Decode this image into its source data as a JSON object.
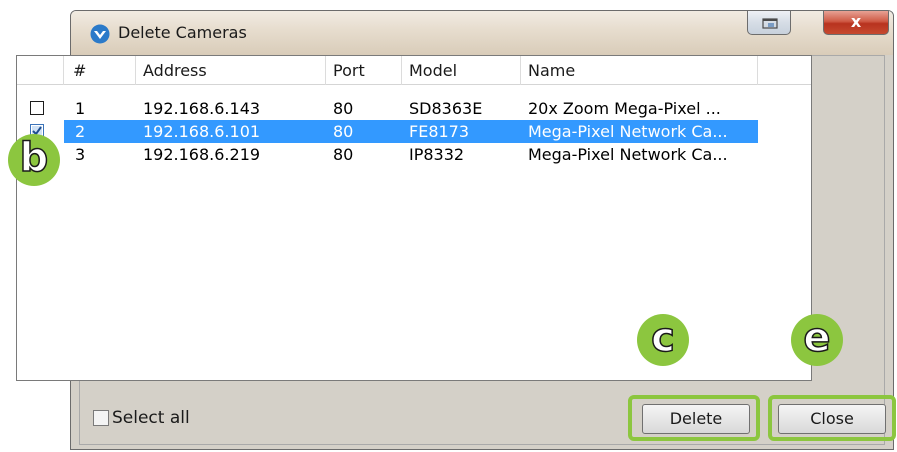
{
  "window": {
    "title": "Delete Cameras",
    "close_glyph": "x"
  },
  "list": {
    "columns": [
      "#",
      "Address",
      "Port",
      "Model",
      "Name"
    ],
    "rows": [
      {
        "checked": false,
        "selected": false,
        "num": "1",
        "address": "192.168.6.143",
        "port": "80",
        "model": "SD8363E",
        "name": "20x Zoom Mega-Pixel ..."
      },
      {
        "checked": true,
        "selected": true,
        "num": "2",
        "address": "192.168.6.101",
        "port": "80",
        "model": "FE8173",
        "name": "Mega-Pixel Network Ca..."
      },
      {
        "checked": false,
        "selected": false,
        "num": "3",
        "address": "192.168.6.219",
        "port": "80",
        "model": "IP8332",
        "name": "Mega-Pixel Network Ca..."
      }
    ]
  },
  "footer": {
    "select_all_label": "Select all",
    "delete_label": "Delete",
    "close_label": "Close"
  },
  "callouts": {
    "b": "b",
    "c": "c",
    "e": "e"
  },
  "colors": {
    "selection": "#3399ff",
    "callout": "#8cc63f",
    "close_button": "#c6492f"
  },
  "icons": {
    "app": "vivotek-logo-icon",
    "restore": "restore-window-icon",
    "close": "close-icon",
    "checkbox": "checkbox-icon"
  }
}
